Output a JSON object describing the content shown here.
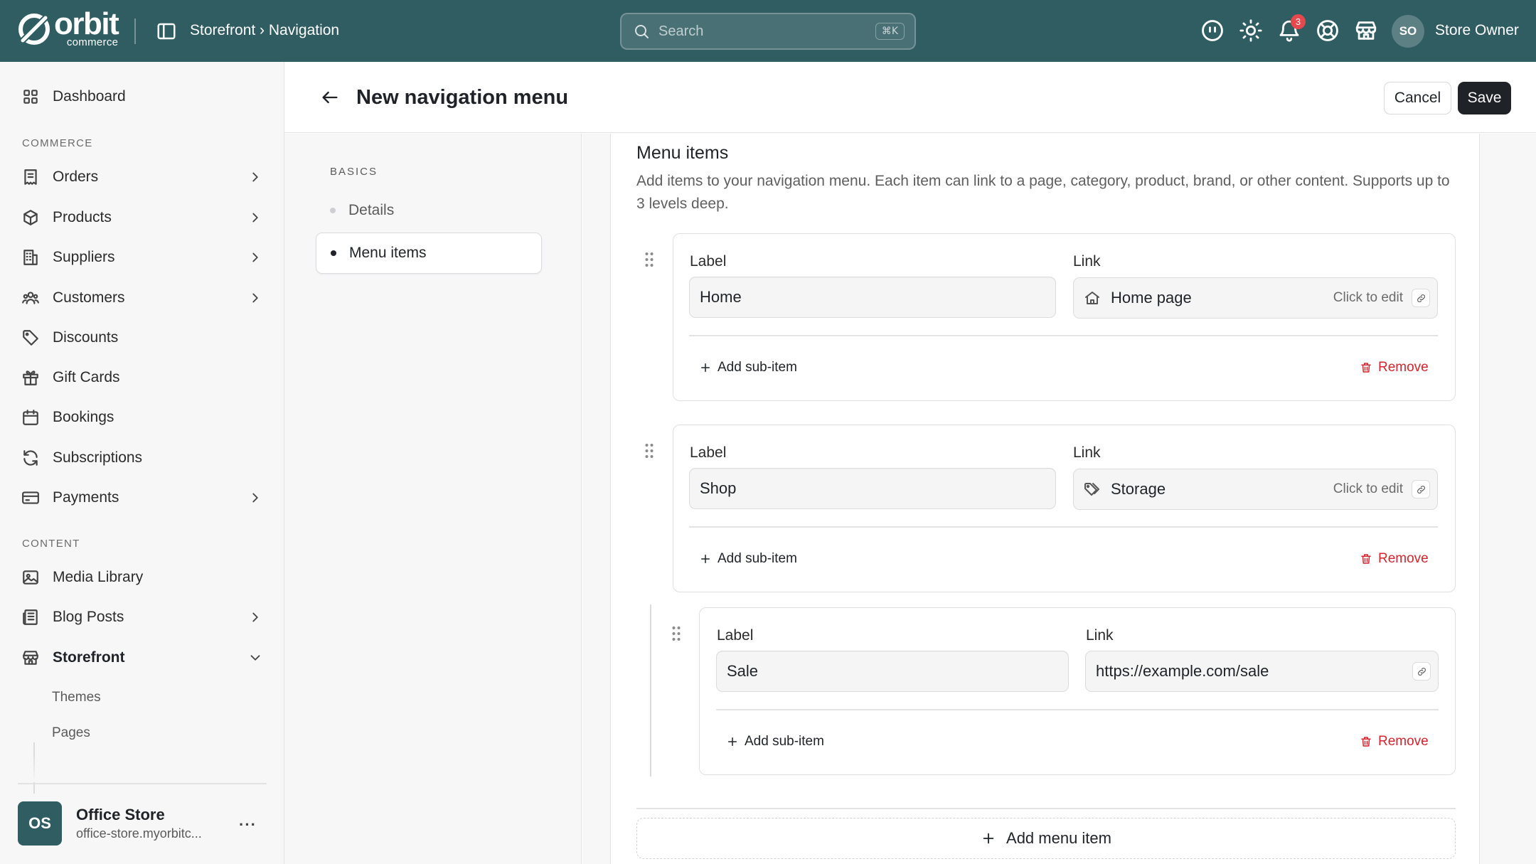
{
  "topbar": {
    "logo_word": "orbit",
    "logo_sub": "commerce",
    "breadcrumb": "Storefront › Navigation",
    "search_placeholder": "Search",
    "search_shortcut": "⌘K",
    "notification_count": "3",
    "user_initials": "SO",
    "user_name": "Store Owner",
    "icons": [
      "toggle-sidebar-icon",
      "ai-assistant-icon",
      "theme-icon",
      "bell-icon",
      "help-icon",
      "store-icon"
    ]
  },
  "sidebar": {
    "dashboard": "Dashboard",
    "commerce_section": "COMMERCE",
    "commerce_items": [
      {
        "label": "Orders",
        "icon": "orders-icon",
        "expandable": true
      },
      {
        "label": "Products",
        "icon": "box-icon",
        "expandable": true
      },
      {
        "label": "Suppliers",
        "icon": "building-icon",
        "expandable": true
      },
      {
        "label": "Customers",
        "icon": "users-icon",
        "expandable": true
      },
      {
        "label": "Discounts",
        "icon": "tag-icon",
        "expandable": false
      },
      {
        "label": "Gift Cards",
        "icon": "gift-icon",
        "expandable": false
      },
      {
        "label": "Bookings",
        "icon": "calendar-icon",
        "expandable": false
      },
      {
        "label": "Subscriptions",
        "icon": "refresh-icon",
        "expandable": false
      },
      {
        "label": "Payments",
        "icon": "card-icon",
        "expandable": true
      }
    ],
    "content_section": "CONTENT",
    "content_items": [
      {
        "label": "Media Library",
        "icon": "image-icon",
        "expandable": false
      },
      {
        "label": "Blog Posts",
        "icon": "newspaper-icon",
        "expandable": true
      },
      {
        "label": "Storefront",
        "icon": "storefront-icon",
        "expanded": true
      }
    ],
    "storefront_sub": [
      "Themes",
      "Pages"
    ],
    "store": {
      "initials": "OS",
      "name": "Office Store",
      "domain": "office-store.myorbitc...",
      "more": "···"
    }
  },
  "page": {
    "title": "New navigation menu",
    "cancel": "Cancel",
    "save": "Save"
  },
  "sections": {
    "title": "BASICS",
    "items": [
      "Details",
      "Menu items"
    ],
    "active": "Menu items"
  },
  "menu_items": {
    "title": "Menu items",
    "description": "Add items to your navigation menu. Each item can link to a page, category, product, brand, or other content. Supports up to 3 levels deep.",
    "field_label": "Label",
    "field_link": "Link",
    "click_to_edit": "Click to edit",
    "add_sub_item": "Add sub-item",
    "remove": "Remove",
    "items": [
      {
        "label": "Home",
        "link": "Home page",
        "link_icon": "home-icon",
        "level": 1
      },
      {
        "label": "Shop",
        "link": "Storage",
        "link_icon": "tags-icon",
        "level": 1
      },
      {
        "label": "Sale",
        "link": "https://example.com/sale",
        "link_icon": "",
        "level": 2
      }
    ],
    "add_menu_item": "Add menu item"
  }
}
